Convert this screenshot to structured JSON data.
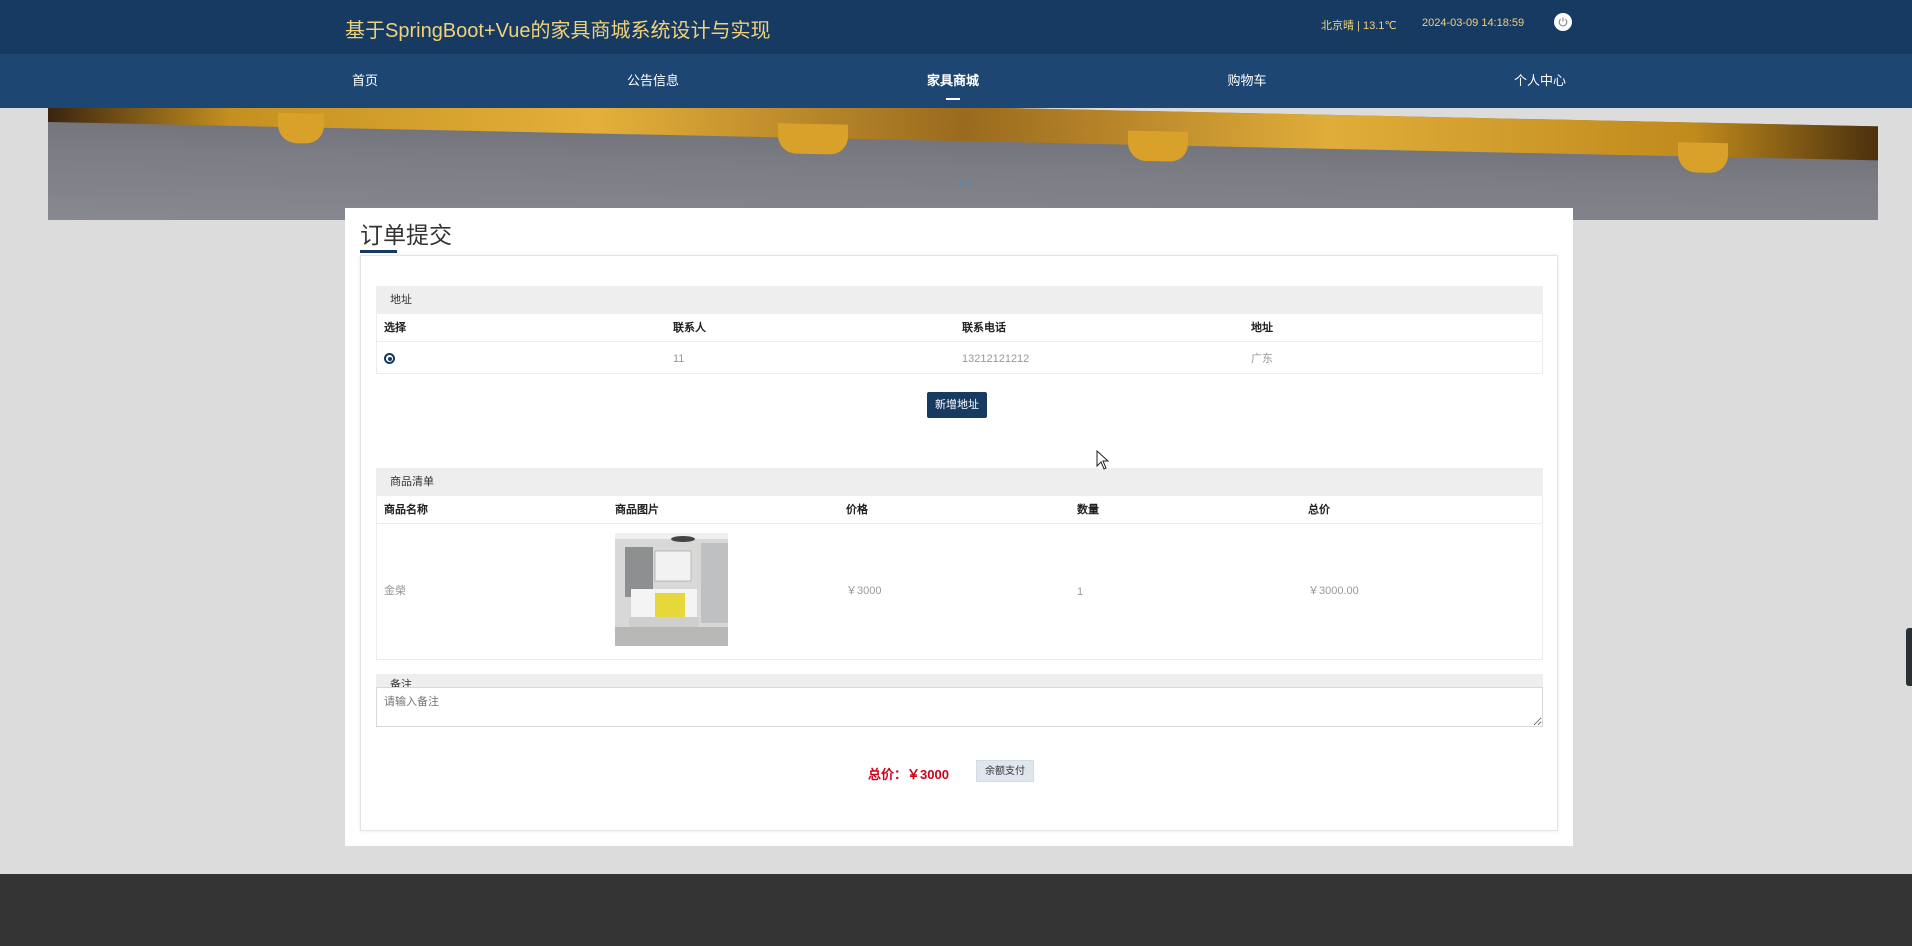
{
  "header": {
    "site_title": "基于SpringBoot+Vue的家具商城系统设计与实现",
    "weather": "北京晴 | 13.1℃",
    "datetime": "2024-03-09  14:18:59",
    "power_icon": "power-icon"
  },
  "nav": {
    "items": [
      {
        "label": "首页"
      },
      {
        "label": "公告信息"
      },
      {
        "label": "家具商城"
      },
      {
        "label": "购物车"
      },
      {
        "label": "个人中心"
      }
    ],
    "active_index": 2
  },
  "page": {
    "title": "订单提交"
  },
  "address_section": {
    "heading": "地址",
    "columns": [
      "选择",
      "联系人",
      "联系电话",
      "地址"
    ],
    "rows": [
      {
        "contact": "11",
        "phone": "13212121212",
        "address": "广东",
        "selected": true
      }
    ],
    "add_button": "新增地址"
  },
  "goods_section": {
    "heading": "商品清单",
    "columns": [
      "商品名称",
      "商品图片",
      "价格",
      "数量",
      "总价"
    ],
    "rows": [
      {
        "name": "金榮",
        "price": "￥3000",
        "quantity": "1",
        "total": "￥3000.00"
      }
    ]
  },
  "remark": {
    "heading": "备注",
    "placeholder": "请输入备注"
  },
  "summary": {
    "total_label": "总价：￥3000",
    "pay_button": "余额支付"
  },
  "colors": {
    "header_bg": "#163a61",
    "nav_bg": "#1d4672",
    "title_gold": "#f0d27a",
    "price_red": "#d0021b"
  }
}
